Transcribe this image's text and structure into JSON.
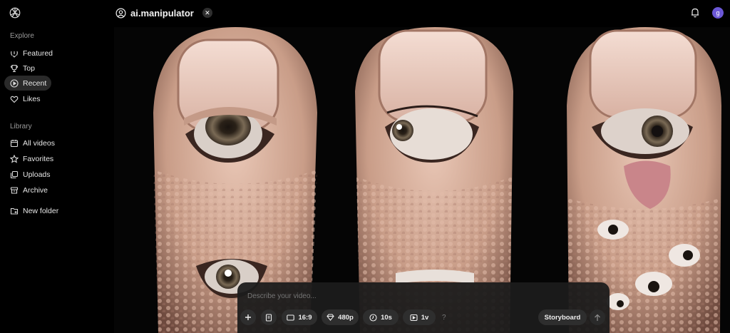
{
  "sidebar": {
    "explore_title": "Explore",
    "library_title": "Library",
    "explore_items": [
      {
        "label": "Featured",
        "icon": "featured-icon"
      },
      {
        "label": "Top",
        "icon": "trophy-icon"
      },
      {
        "label": "Recent",
        "icon": "play-circle-icon",
        "active": true
      },
      {
        "label": "Likes",
        "icon": "heart-icon"
      }
    ],
    "library_items": [
      {
        "label": "All videos",
        "icon": "calendar-icon"
      },
      {
        "label": "Favorites",
        "icon": "star-icon"
      },
      {
        "label": "Uploads",
        "icon": "uploads-icon"
      },
      {
        "label": "Archive",
        "icon": "archive-icon"
      },
      {
        "label": "New folder",
        "icon": "new-folder-icon"
      }
    ]
  },
  "header": {
    "username": "ai.manipulator",
    "avatar_letter": "g",
    "avatar_color": "#6b57d6"
  },
  "composer": {
    "placeholder": "Describe your video...",
    "aspect_label": "16:9",
    "resolution_label": "480p",
    "duration_label": "10s",
    "variations_label": "1v",
    "help_label": "?",
    "storyboard_label": "Storyboard"
  }
}
